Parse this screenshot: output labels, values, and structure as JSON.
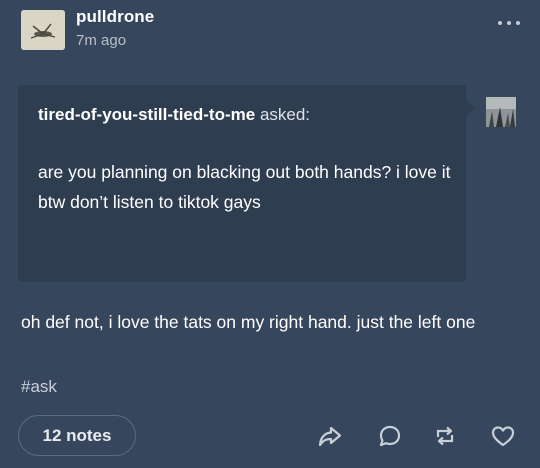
{
  "post": {
    "blog_name": "pulldrone",
    "timestamp": "7m ago",
    "more_icon": "more-horizontal-icon"
  },
  "ask": {
    "asker": "tired-of-you-still-tied-to-me",
    "asked_suffix": "asked:",
    "question": "are you planning on blacking out both hands? i love it btw don’t listen to tiktok gays"
  },
  "answer": {
    "text": "oh def not, i love the tats on my right hand. just the left one",
    "tag": "#ask"
  },
  "footer": {
    "notes_label": "12 notes",
    "icons": [
      "share-icon",
      "reply-icon",
      "reblog-icon",
      "like-icon"
    ]
  },
  "colors": {
    "background": "#36465d",
    "ask_background": "#2f3d51",
    "secondary_text": "#b8bfc9"
  }
}
